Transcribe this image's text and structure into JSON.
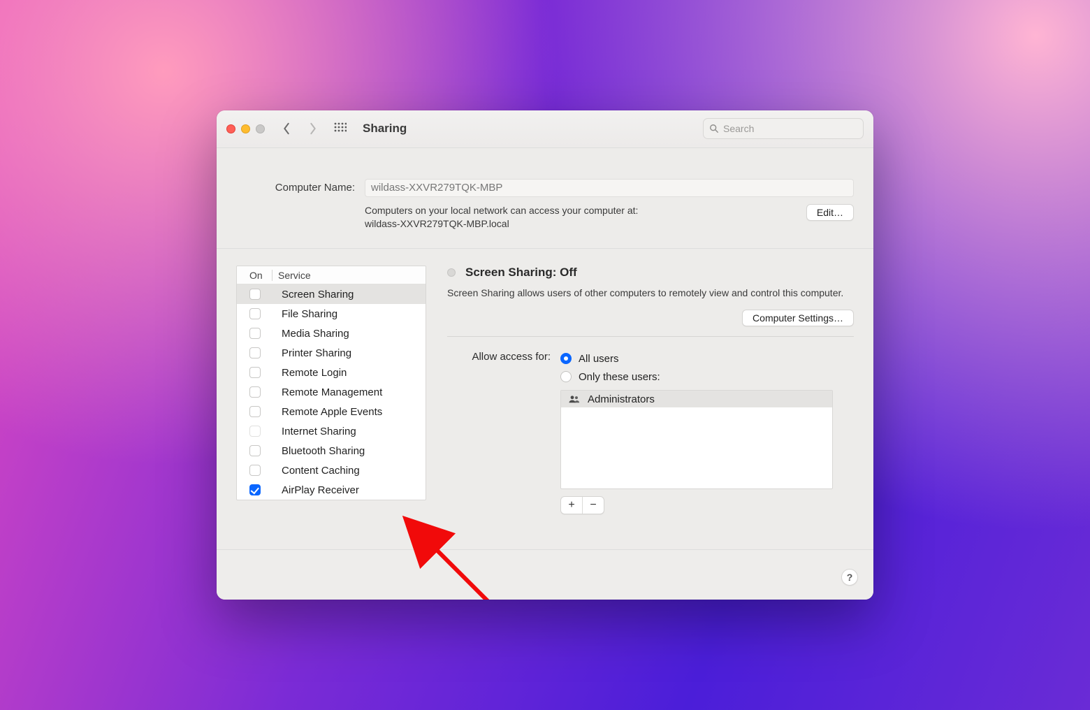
{
  "titlebar": {
    "title": "Sharing",
    "search_placeholder": "Search"
  },
  "top": {
    "name_label": "Computer Name:",
    "name_value": "wildass-XXVR279TQK-MBP",
    "desc_line1": "Computers on your local network can access your computer at:",
    "desc_line2": "wildass-XXVR279TQK-MBP.local",
    "edit_button": "Edit…"
  },
  "services": {
    "header_on": "On",
    "header_service": "Service",
    "items": [
      {
        "label": "Screen Sharing",
        "checked": false,
        "selected": true
      },
      {
        "label": "File Sharing",
        "checked": false,
        "selected": false
      },
      {
        "label": "Media Sharing",
        "checked": false,
        "selected": false
      },
      {
        "label": "Printer Sharing",
        "checked": false,
        "selected": false
      },
      {
        "label": "Remote Login",
        "checked": false,
        "selected": false
      },
      {
        "label": "Remote Management",
        "checked": false,
        "selected": false
      },
      {
        "label": "Remote Apple Events",
        "checked": false,
        "selected": false
      },
      {
        "label": "Internet Sharing",
        "checked": false,
        "selected": false
      },
      {
        "label": "Bluetooth Sharing",
        "checked": false,
        "selected": false
      },
      {
        "label": "Content Caching",
        "checked": false,
        "selected": false
      },
      {
        "label": "AirPlay Receiver",
        "checked": true,
        "selected": false
      }
    ]
  },
  "detail": {
    "heading": "Screen Sharing: Off",
    "description": "Screen Sharing allows users of other computers to remotely view and control this computer.",
    "computer_settings_button": "Computer Settings…",
    "access_label": "Allow access for:",
    "access_options": {
      "all": "All users",
      "only": "Only these users:"
    },
    "access_selected": "all",
    "users": [
      {
        "label": "Administrators"
      }
    ],
    "add_label": "+",
    "remove_label": "−"
  },
  "footer": {
    "help_label": "?"
  }
}
